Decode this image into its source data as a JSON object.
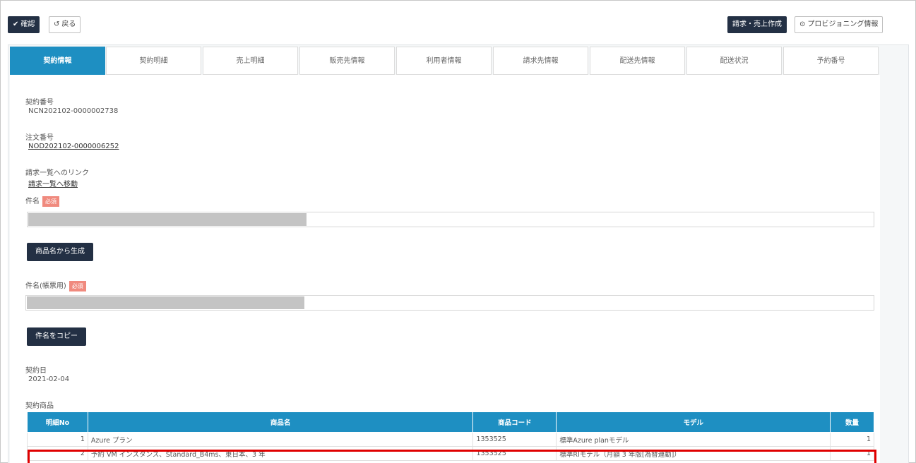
{
  "toolbar": {
    "confirm_label": "確認",
    "back_label": "戻る",
    "billing_label": "請求・売上作成",
    "provisioning_label": "プロビジョニング情報"
  },
  "tabs": [
    "契約情報",
    "契約明細",
    "売上明細",
    "販売先情報",
    "利用者情報",
    "請求先情報",
    "配送先情報",
    "配送状況",
    "予約番号"
  ],
  "contract": {
    "contract_no_label": "契約番号",
    "contract_no": "NCN202102-0000002738",
    "order_no_label": "注文番号",
    "order_no": "NOD202102-0000006252",
    "invoice_link_label": "請求一覧へのリンク",
    "invoice_link": "請求一覧へ移動",
    "subject_label": "件名",
    "required_label": "必須",
    "generate_label": "商品名から生成",
    "subject_invoice_label": "件名(帳票用)",
    "copy_label": "件名をコピー",
    "contract_date_label": "契約日",
    "contract_date": "2021-02-04",
    "products_label": "契約商品"
  },
  "products_table": {
    "headers": [
      "明細No",
      "商品名",
      "商品コード",
      "モデル",
      "数量"
    ],
    "rows": [
      [
        "1",
        "Azure プラン",
        "1353525",
        "標準Azure planモデル",
        "1"
      ],
      [
        "2",
        "予約 VM インスタンス、Standard_B4ms、東日本、3 年",
        "1353525",
        "標準RIモデル（月額 3 年版[為替連動]）",
        "1"
      ]
    ],
    "highlight_color": "#e00000"
  },
  "colors": {
    "accent": "#1e8fc2",
    "dark": "#233044",
    "required": "#f08a7e"
  }
}
